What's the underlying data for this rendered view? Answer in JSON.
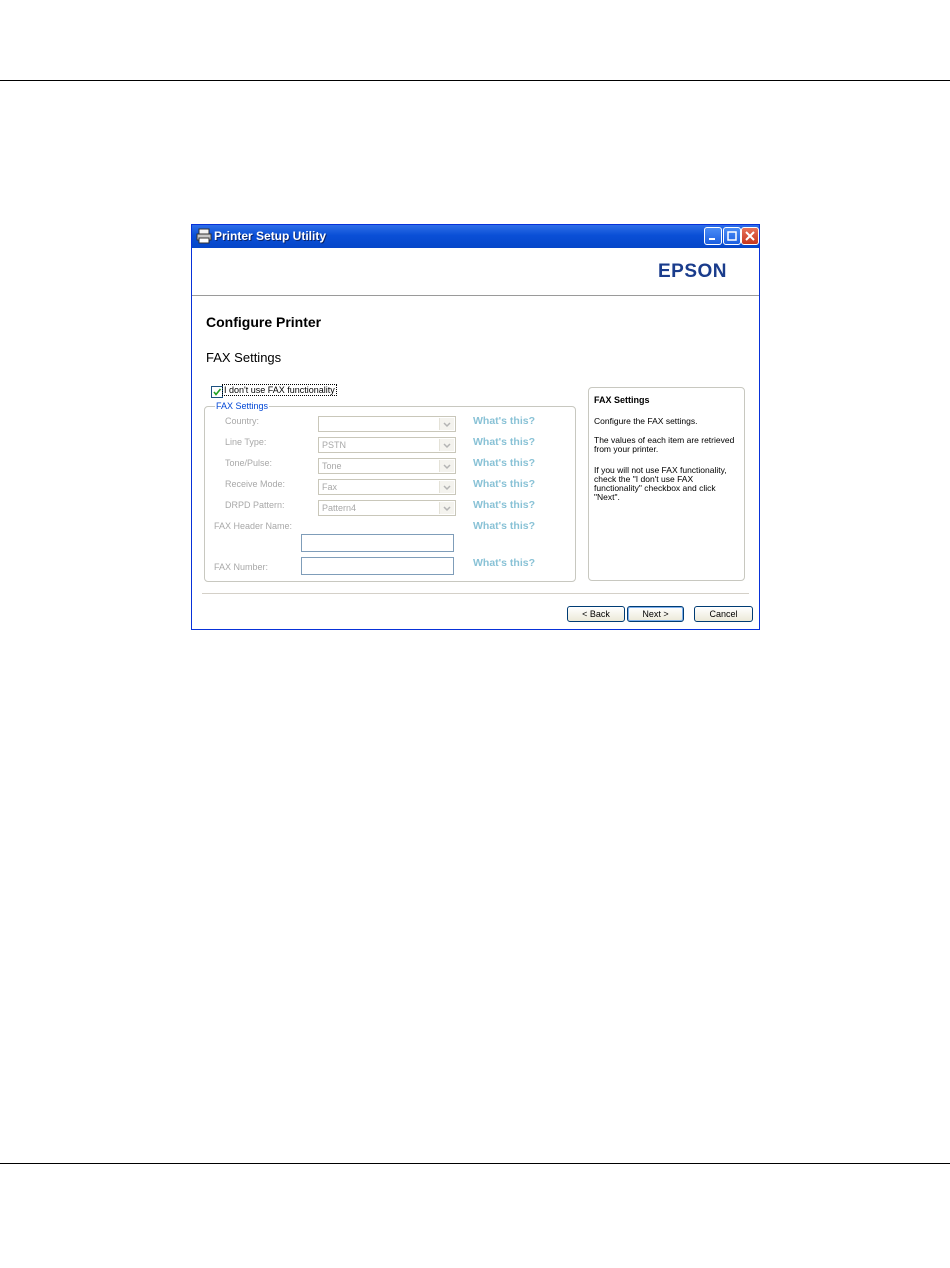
{
  "window": {
    "title": "Printer Setup Utility",
    "brand": "EPSON"
  },
  "page": {
    "title": "Configure Printer",
    "section": "FAX Settings"
  },
  "checkbox": {
    "label": "I don't use FAX functionality",
    "checked": true
  },
  "group": {
    "legend": "FAX Settings",
    "fields": [
      {
        "label": "Country:",
        "value": "",
        "help": "What's this?"
      },
      {
        "label": "Line Type:",
        "value": "PSTN",
        "help": "What's this?"
      },
      {
        "label": "Tone/Pulse:",
        "value": "Tone",
        "help": "What's this?"
      },
      {
        "label": "Receive Mode:",
        "value": "Fax",
        "help": "What's this?"
      },
      {
        "label": "DRPD Pattern:",
        "value": "Pattern4",
        "help": "What's this?"
      }
    ],
    "header_name": {
      "label": "FAX Header Name:",
      "value": "",
      "help": "What's this?"
    },
    "fax_number": {
      "label": "FAX Number:",
      "value": "",
      "help": "What's this?"
    }
  },
  "side_panel": {
    "title": "FAX Settings",
    "paragraphs": [
      "Configure the FAX settings.",
      "The values of each item are retrieved from your printer.",
      "If you will not use FAX functionality, check the \"I don't use FAX functionality\" checkbox and click \"Next\"."
    ]
  },
  "buttons": {
    "back": "< Back",
    "next": "Next >",
    "cancel": "Cancel"
  },
  "colors": {
    "titlebar": "#0a4fd6",
    "help_link": "#89c2d6",
    "legend": "#0046d5"
  }
}
